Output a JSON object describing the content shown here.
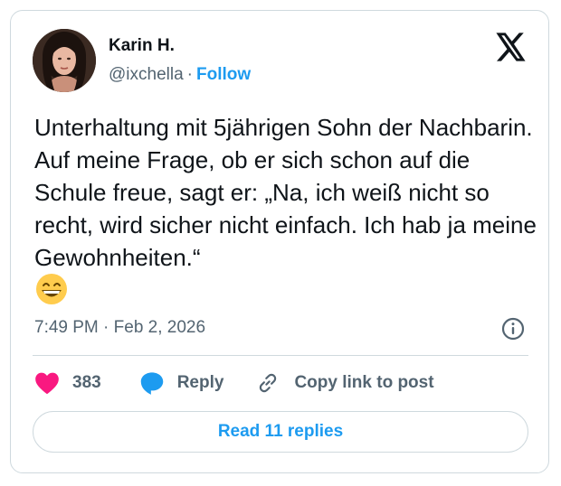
{
  "author": {
    "name": "Karin H.",
    "handle": "@ixchella",
    "separator": "·",
    "follow_label": "Follow"
  },
  "tweet": {
    "text": "Unterhaltung mit 5jährigen Sohn der Nachbarin. Auf meine Frage, ob er sich schon auf die Schule freue, sagt er: „Na, ich weiß nicht so recht, wird sicher nicht einfach. Ich hab ja meine Gewohnheiten.“",
    "emoji": "grinning-face-with-smiling-eyes",
    "timestamp": "7:49 PM · Feb 2, 2026"
  },
  "actions": {
    "like_count": "383",
    "reply_label": "Reply",
    "copy_link_label": "Copy link to post"
  },
  "read_replies_label": "Read 11 replies",
  "icons": {
    "platform": "x-logo-icon",
    "info": "info-icon",
    "like": "heart-icon",
    "reply": "speech-bubble-icon",
    "copy": "link-icon"
  },
  "colors": {
    "accent": "#1d9bf0",
    "like": "#f91880",
    "text": "#0f1419",
    "secondary": "#536471",
    "border": "#cfd9de"
  }
}
